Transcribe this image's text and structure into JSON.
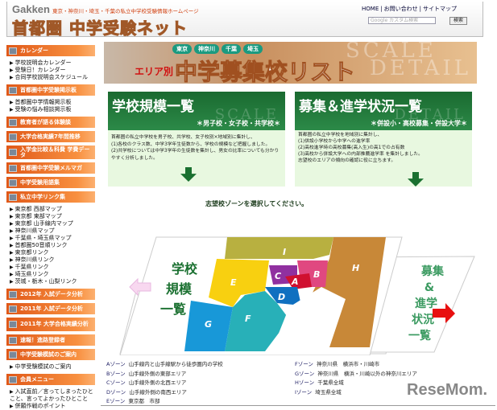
{
  "header": {
    "brand": "Gakken",
    "tagline": "東京・神奈川・埼玉・千葉の私立中学校受験情報ホームページ",
    "site_title": "首都圏 中学受験ネット",
    "links": [
      "HOME",
      "お問い合わせ",
      "サイトマップ"
    ],
    "search_placeholder": "Google カスタム検索",
    "search_button": "検索"
  },
  "sidebar": [
    {
      "head": "カレンダー",
      "links": [
        "学校説明会カレンダー",
        "受験日！カレンダー",
        "合同学校説明会スケジュール"
      ]
    },
    {
      "head": "首都圏中学受験掲示板",
      "links": [
        "首都圏中学情報掲示板",
        "受験の悩み相談掲示板"
      ]
    },
    {
      "head": "教育者が語る体験談",
      "links": []
    },
    {
      "head": "大学合格実績7年間推移",
      "links": []
    },
    {
      "head": "入学金比較＆科費 学費データ",
      "links": [],
      "tall": true
    },
    {
      "head": "首都圏中学受験メルマガ",
      "links": []
    },
    {
      "head": "中学受験用語集",
      "links": []
    },
    {
      "head": "私立中学リンク集",
      "links": [
        "東京都 西部マップ",
        "東京都 東部マップ",
        "東京都 山手線内マップ",
        "神奈川県マップ",
        "千葉県・埼玉県マップ",
        "首都圏50音順リンク",
        "東京都リンク",
        "神奈川県リンク",
        "千葉県リンク",
        "埼玉県リンク",
        "茨城・栃木・山梨リンク"
      ]
    },
    {
      "head": "2012年 入試データ分析",
      "links": []
    },
    {
      "head": "2011年 入試データ分析",
      "links": []
    },
    {
      "head": "2011年 大学合格実績分析",
      "links": [],
      "tall": true
    },
    {
      "head": "速報！進路登録者",
      "links": []
    },
    {
      "head": "中学受験模試のご案内",
      "links": [
        "中学受験模試のご案内"
      ]
    },
    {
      "head": "会員メニュー",
      "links": [
        "入試直前／言ってしまったひとこと、言ってよかったひとこと",
        "併願作戦のポイント"
      ]
    }
  ],
  "banner": {
    "area": "エリア別",
    "title": "中学募集校リスト",
    "regions": [
      "東京",
      "神奈川",
      "千葉",
      "埼玉"
    ],
    "wm1": "SCALE",
    "wm2": "DETAIL"
  },
  "boxes": [
    {
      "title": "学校規模一覧",
      "wm": "SCALE",
      "sub": "＊男子校・女子校・共学校＊",
      "lines": [
        "首都圏の私立中学校を男子校、共学校、女子校別×地域別に集計し、",
        "(1)各校のクラス数、中学3学年生徒数から、学校の規模など把握しました。",
        "(2)共学校については中学3学年の生徒数を集計し、男女の比率についても分かりやすく分析しました。"
      ]
    },
    {
      "title": "募集＆進学状況一覧",
      "wm": "DETAIL",
      "sub": "＊併設小・高校募集・併設大学＊",
      "lines": [
        "首都圏の私立中学校を地域別に集計し、",
        "(1)併設小学校から中学への進学率",
        "(2)高校進学時の高校募集(高入生)の高1での占有数",
        "(3)高校から併設大学への内部推薦進学率 を集計しました。",
        "志望校のエリアの傾向の確認に役に立ちます。"
      ]
    }
  ],
  "map": {
    "prompt": "志望校ゾーンを選択してください。",
    "left_label": [
      "学校",
      "規模",
      "一覧"
    ],
    "right_label": [
      "募集",
      "&",
      "進学",
      "状況",
      "一覧"
    ],
    "zones": [
      "A",
      "B",
      "C",
      "D",
      "E",
      "F",
      "G",
      "H",
      "I"
    ]
  },
  "zones_left": [
    {
      "k": "Aゾーン",
      "v": "山手線内と山手線駅から徒歩圏内の学校"
    },
    {
      "k": "Bゾーン",
      "v": "山手線外側の東部エリア"
    },
    {
      "k": "Cゾーン",
      "v": "山手線外側の北西エリア"
    },
    {
      "k": "Dゾーン",
      "v": "山手線外側の南西エリア"
    },
    {
      "k": "Eゾーン",
      "v": "東京都　市部"
    }
  ],
  "zones_right": [
    {
      "k": "Fゾーン",
      "v": "神奈川県　横浜市・川崎市"
    },
    {
      "k": "Gゾーン",
      "v": "神奈川県　横浜・川崎以外の神奈川エリア"
    },
    {
      "k": "Hゾーン",
      "v": "千葉県全域"
    },
    {
      "k": "Iゾーン",
      "v": "埼玉県全域"
    }
  ],
  "watermark": "ReseMom."
}
